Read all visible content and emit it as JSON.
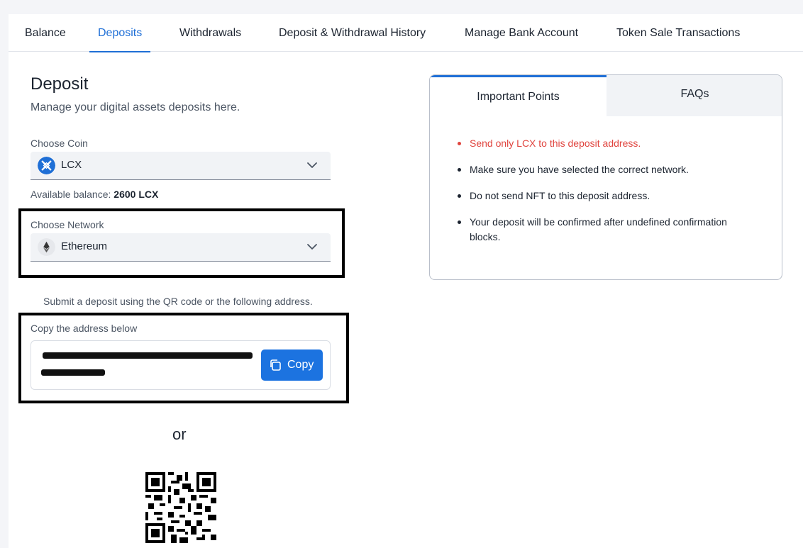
{
  "tabs": [
    {
      "label": "Balance"
    },
    {
      "label": "Deposits",
      "active": true
    },
    {
      "label": "Withdrawals"
    },
    {
      "label": "Deposit & Withdrawal History"
    },
    {
      "label": "Manage Bank Account"
    },
    {
      "label": "Token Sale Transactions"
    }
  ],
  "deposit": {
    "title": "Deposit",
    "subtitle": "Manage your digital assets deposits here.",
    "coin_label": "Choose Coin",
    "coin_value": "LCX",
    "coin_icon": "lcx-coin-icon",
    "balance_label": "Available balance:",
    "balance_value": "2600 LCX",
    "network_label": "Choose Network",
    "network_value": "Ethereum",
    "network_icon": "ethereum-icon",
    "hint": "Submit a deposit using the QR code or the following address.",
    "address_label": "Copy the address below",
    "copy_label": "Copy",
    "or_text": "or"
  },
  "info_panel": {
    "tab_points": "Important Points",
    "tab_faqs": "FAQs",
    "points": [
      "Send only LCX to this deposit address.",
      "Make sure you have selected the correct network.",
      "Do not send NFT to this deposit address.",
      "Your deposit will be confirmed after undefined confirmation blocks."
    ]
  },
  "colors": {
    "accent": "#1f6fd6",
    "copy_button": "#1c73e0",
    "warning": "#e0443e"
  }
}
